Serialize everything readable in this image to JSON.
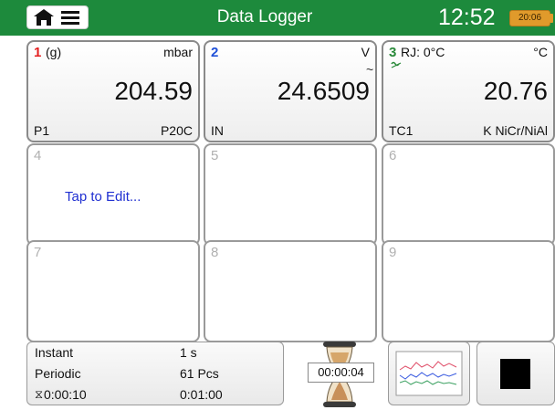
{
  "header": {
    "title": "Data Logger",
    "clock": "12:52",
    "battery_time": "20:06",
    "bg_color": "#1d8a3c",
    "icons": [
      "home-icon",
      "menu-icon"
    ]
  },
  "panels": [
    {
      "num": "1",
      "unit_note": "(g)",
      "unit": "mbar",
      "value": "204.59",
      "bottom_left": "P1",
      "bottom_right": "P20C"
    },
    {
      "num": "2",
      "unit": "V",
      "value": "24.6509",
      "bottom_left": "IN"
    },
    {
      "num": "3",
      "rj": "RJ: 0°C",
      "unit": "°C",
      "value": "20.76",
      "bottom_left": "TC1",
      "bottom_right": "K  NiCr/NiAl"
    },
    {
      "num": "4",
      "tap": "Tap to Edit..."
    },
    {
      "num": "5"
    },
    {
      "num": "6"
    },
    {
      "num": "7"
    },
    {
      "num": "8"
    },
    {
      "num": "9"
    }
  ],
  "status": {
    "instant_label": "Instant",
    "instant_value": "1 s",
    "periodic_label": "Periodic",
    "periodic_value": "61 Pcs",
    "elapsed": "0:00:10",
    "duration": "0:01:00"
  },
  "timer": "00:00:04"
}
